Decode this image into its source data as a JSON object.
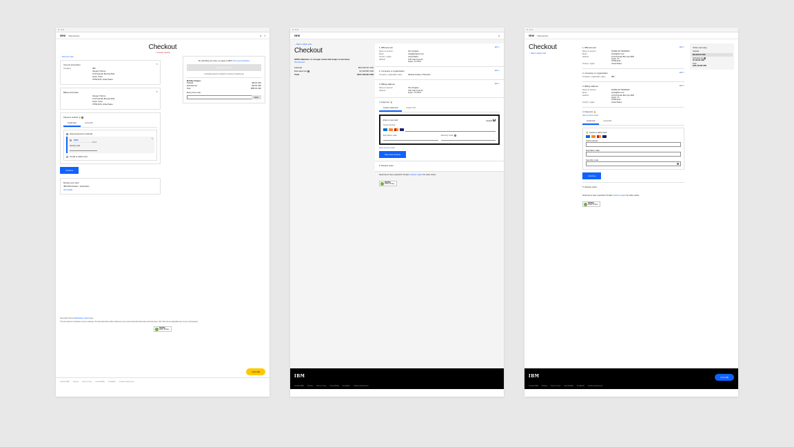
{
  "brand": "IBM",
  "marketplace": "Marketplace",
  "checkout_title": "Checkout",
  "back_link": "Back to adjust order",
  "session_warning": "Session warning",
  "edit_link": "Edit",
  "edit_order_link": "Edit your order",
  "truste": {
    "name": "TRUSTe",
    "sub": "APEC Privacy"
  },
  "footer_links": [
    "Contact IBM",
    "Privacy",
    "Terms of use",
    "Accessibility",
    "Feedback",
    "Cookie preferences"
  ],
  "lets_talk": "Let's talk",
  "m1": {
    "account": {
      "title": "Account information",
      "rows": [
        [
          "Company",
          "IBM"
        ],
        [
          "",
          "Xianguo Trofimov"
        ],
        [
          "",
          "11721 Domain Blvd Apt 3510"
        ],
        [
          "",
          "Austin, Texas"
        ],
        [
          "",
          "78758-3106, United States"
        ]
      ]
    },
    "billing": {
      "title": "Billing information",
      "rows": [
        [
          "",
          "Xianguo Trofimov"
        ],
        [
          "",
          "11721 Domain Blvd Apt 3510"
        ],
        [
          "",
          "Austin, Texas"
        ],
        [
          "",
          "78758-3106, United States"
        ]
      ]
    },
    "payment": {
      "title": "Payment method",
      "tabs": [
        "Credit Card",
        "Invoice/PO"
      ],
      "saved_hdr": "Saved payment methods",
      "visa": "VISA",
      "mask": "···· ···· ···· 3210",
      "sec_label": "Security code",
      "opt2": "Credit or debit card"
    },
    "sidebar": {
      "terms_intro": "By submitting your order, you agree to IBM's",
      "terms_link": "Terms and Conditions",
      "submit": "Submit your order",
      "hint": "Complete payment method to continue checking out",
      "monthly_hdr": "Monthly charges:",
      "rows": [
        [
          "Subtotal",
          "$99.00 USD"
        ],
        [
          "Estimated tax",
          "$32.90 USD"
        ],
        [
          "Total",
          "$555.93 USD"
        ]
      ],
      "promo_label": "Enter promo code:",
      "apply": "Apply"
    },
    "continue": "Continue",
    "review": {
      "title": "Review your order",
      "item": "IBM SPSS Modeler - Subscription",
      "view": "View details"
    },
    "need_help": "Need help? Visit our",
    "need_help_link": "Marketplace support",
    "need_help_end": " page.",
    "disclaimer": "*The tax amount in checkout is only an estimate. The final total shown will be reflected on your invoice and will include state and local taxes, GST, VAT and any applicable fees in your country/region."
  },
  "m2": {
    "product": "SPSS Statistics or a longer name that wraps to two lines",
    "product_link": "View this item",
    "totals": [
      [
        "Subtotal",
        "$94,392.00 USD"
      ],
      [
        "Estimated tax",
        "$7,400.88 USD"
      ],
      [
        "Total",
        "$101,792.99 USD"
      ]
    ],
    "s1": {
      "title": "1. IBM account",
      "rows": [
        [
          "Name on account",
          "Tam Chugboo"
        ],
        [
          "Email",
          "tchug@us@xyz.com"
        ],
        [
          "Country / region",
          "United States"
        ],
        [
          "Address",
          "1337 Oak Creek Dr\nAustin, TX 78727"
        ]
      ]
    },
    "s2": {
      "title": "2. Company or organization",
      "rows": [
        [
          "Company / organization name",
          "National Institute of Helvetica"
        ]
      ]
    },
    "s3": {
      "title": "3. Billing address",
      "rows": [
        [
          "Name on account",
          "Tam Chugboo"
        ],
        [
          "Address",
          "1337 Oak Creek Dr\nAustin, TX 78727"
        ]
      ]
    },
    "s4": {
      "title": "4. Payment",
      "tabs": [
        "Credit or debit card",
        "Invoice / PO"
      ],
      "enter": "Enter a new card",
      "default": "Default",
      "fields": {
        "num": "Card number",
        "exp": "Expiration date",
        "sec": "Security code"
      },
      "promo_q": "Have a promo code?",
      "save": "Save and continue"
    },
    "s5": "5. Review order",
    "help": "Need help or have a question? Contact",
    "help_link": "customer support",
    "help_end": "for online orders."
  },
  "m3": {
    "s1": {
      "title": "1. IBM account",
      "rows": [
        [
          "Name on account",
          "SHODE SH TROFIMOV"
        ],
        [
          "Email",
          "shode@ibm.com"
        ],
        [
          "Address",
          "11721 Domain Blvd, Apt 3205\nAustin, TX\n78758-3102"
        ],
        [
          "Country / region",
          "United States"
        ]
      ]
    },
    "s2": {
      "title": "2. Company or organization",
      "rows": [
        [
          "Company / organization name",
          "IBM"
        ]
      ]
    },
    "s3": {
      "title": "3. Billing address",
      "rows": [
        [
          "Name on account",
          "SHODE SH TROFIMOV"
        ],
        [
          "Email",
          "shode@ibm.com"
        ],
        [
          "Address",
          "11721 Domain Blvd, Apt 3205\nAustin, TX\n78758-3102"
        ],
        [
          "Country / region",
          "United States"
        ]
      ]
    },
    "s4": {
      "title": "4. Payment",
      "promo_q": "Have a promo code?",
      "tabs": [
        "Credit card",
        "Invoice/PO"
      ],
      "card_lbl": "Credit or debit card",
      "fields": {
        "num": "Card number",
        "exp": "Expiration date",
        "sec": "Security code"
      },
      "continue": "Continue"
    },
    "s5": "5. Review order",
    "help": "Need help or have a question? Contact",
    "help_link": "customer support",
    "help_end": "for online orders.",
    "order_summary": {
      "title": "Order summary",
      "rows": [
        [
          "Subtotal",
          "$94,392.00 USD"
        ],
        [
          "Estimated tax",
          "$7,400.88 USD"
        ],
        [
          "Total",
          "$101,792.88 USD"
        ]
      ]
    }
  }
}
